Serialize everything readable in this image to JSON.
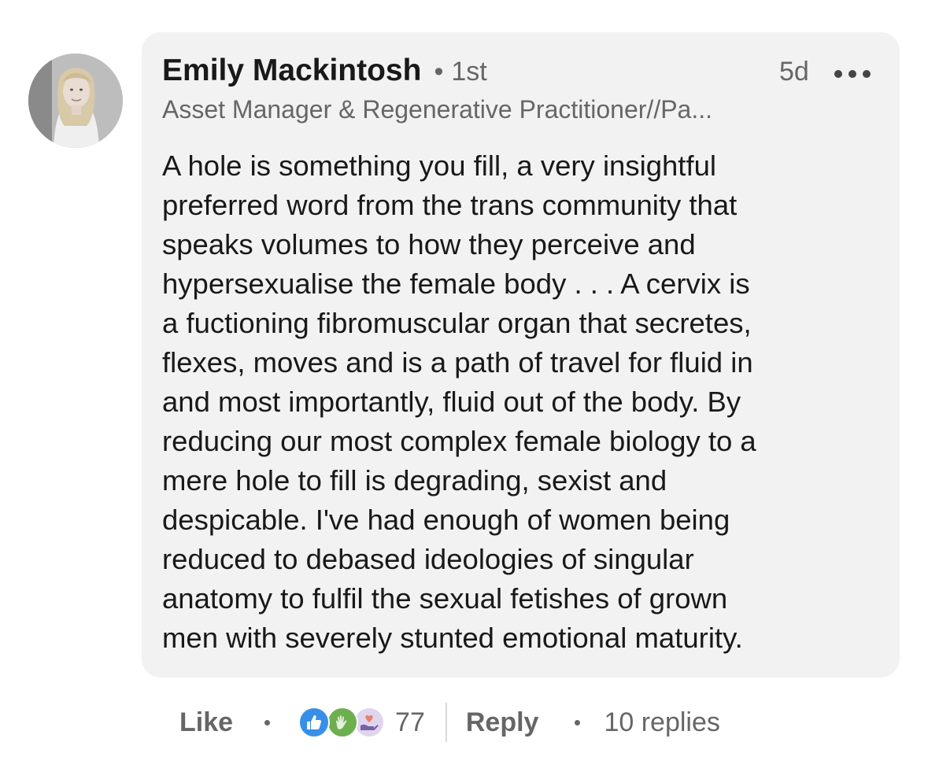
{
  "comment": {
    "author": {
      "name": "Emily Mackintosh",
      "connection_degree": "1st",
      "headline": "Asset Manager & Regenerative Practitioner//Pa..."
    },
    "separator": "•",
    "timestamp": "5d",
    "body_lines": [
      "A hole is something you fill, a very insightful",
      "preferred word from the trans community that",
      "speaks volumes to how they perceive and",
      "hypersexualise the female body . . . A cervix is",
      "a fuctioning fibromuscular organ that secretes,",
      "flexes, moves and is a path of travel for fluid in",
      "and most importantly, fluid out of the body. By",
      "reducing our most complex female biology to a",
      "mere hole to fill is degrading, sexist and",
      "despicable. I've had enough of women being",
      "reduced to debased ideologies of singular",
      "anatomy to fulfil the sexual fetishes of grown",
      "men with severely stunted emotional maturity."
    ]
  },
  "actions": {
    "like_label": "Like",
    "reactions": [
      {
        "icon": "thumbs-up-icon",
        "color": "#378fe9"
      },
      {
        "icon": "clapping-hands-icon",
        "color": "#6dae4f"
      },
      {
        "icon": "heart-hand-icon",
        "color": "#dfd6ee"
      }
    ],
    "reaction_count": "77",
    "reply_label": "Reply",
    "replies_count_label": "10 replies"
  },
  "colors": {
    "text_primary": "#191919",
    "text_secondary": "#666666",
    "bubble_background": "#f2f2f2"
  }
}
